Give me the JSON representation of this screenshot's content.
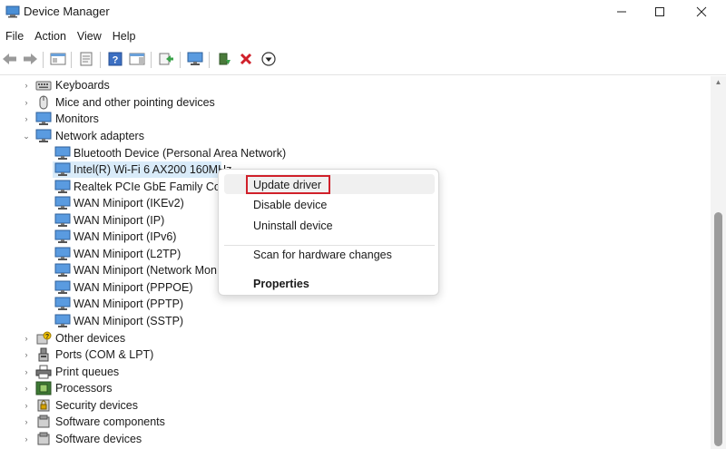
{
  "window": {
    "title": "Device Manager",
    "app_icon": "device-manager-icon",
    "controls": [
      "minimize-icon",
      "maximize-icon",
      "close-icon"
    ]
  },
  "menubar": {
    "file": "File",
    "action": "Action",
    "view": "View",
    "help": "Help"
  },
  "toolbar": {
    "buttons": [
      "back-arrow-icon",
      "forward-arrow-icon",
      "show-hide-console-tree-icon",
      "properties-icon",
      "help-icon",
      "action-pane-icon",
      "export-icon",
      "scan-hardware-icon",
      "update-driver-icon",
      "uninstall-icon",
      "download-icon"
    ],
    "accent_red": "#d0202a"
  },
  "tree": {
    "categories": [
      {
        "label": "Keyboards",
        "icon": "keyboard-icon",
        "expanded": false
      },
      {
        "label": "Mice and other pointing devices",
        "icon": "mouse-icon",
        "expanded": false
      },
      {
        "label": "Monitors",
        "icon": "monitor-icon",
        "expanded": false
      },
      {
        "label": "Network adapters",
        "icon": "network-adapter-icon",
        "expanded": true
      }
    ],
    "network_adapters": [
      {
        "label": "Bluetooth Device (Personal Area Network)",
        "selected": false
      },
      {
        "label": "Intel(R) Wi-Fi 6 AX200 160MHz",
        "selected": true
      },
      {
        "label": "Realtek PCIe GbE Family Contr",
        "selected": false
      },
      {
        "label": "WAN Miniport (IKEv2)",
        "selected": false
      },
      {
        "label": "WAN Miniport (IP)",
        "selected": false
      },
      {
        "label": "WAN Miniport (IPv6)",
        "selected": false
      },
      {
        "label": "WAN Miniport (L2TP)",
        "selected": false
      },
      {
        "label": "WAN Miniport (Network Mon",
        "selected": false
      },
      {
        "label": "WAN Miniport (PPPOE)",
        "selected": false
      },
      {
        "label": "WAN Miniport (PPTP)",
        "selected": false
      },
      {
        "label": "WAN Miniport (SSTP)",
        "selected": false
      }
    ],
    "categories_after": [
      {
        "label": "Other devices",
        "icon": "unknown-device-icon"
      },
      {
        "label": "Ports (COM & LPT)",
        "icon": "port-icon"
      },
      {
        "label": "Print queues",
        "icon": "printer-icon"
      },
      {
        "label": "Processors",
        "icon": "processor-icon"
      },
      {
        "label": "Security devices",
        "icon": "security-device-icon"
      },
      {
        "label": "Software components",
        "icon": "software-component-icon"
      },
      {
        "label": "Software devices",
        "icon": "software-device-icon"
      }
    ],
    "selection_color": "#d9ebf9"
  },
  "context_menu": {
    "update_driver": "Update driver",
    "disable_device": "Disable device",
    "uninstall_device": "Uninstall device",
    "scan_hardware": "Scan for hardware changes",
    "properties": "Properties",
    "highlight_border_color": "#d0202a"
  },
  "watermark": ""
}
